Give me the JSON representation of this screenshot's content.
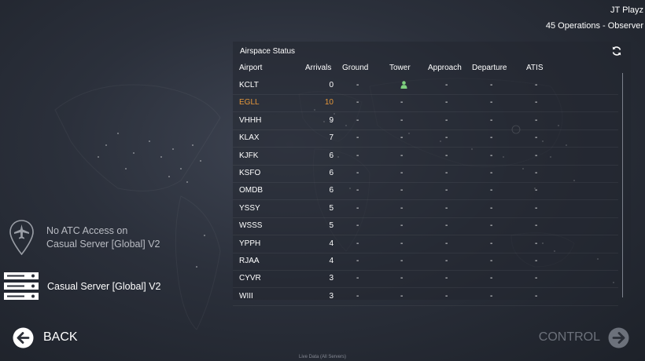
{
  "user": {
    "name": "JT Playz",
    "status": "45 Operations - Observer"
  },
  "panel": {
    "title": "Airspace Status",
    "columns": [
      "Airport",
      "Arrivals",
      "Ground",
      "Tower",
      "Approach",
      "Departure",
      "ATIS"
    ],
    "rows": [
      {
        "airport": "KCLT",
        "arrivals": "0",
        "ground": "-",
        "tower": "controller-icon",
        "approach": "-",
        "departure": "-",
        "atis": "-"
      },
      {
        "airport": "EGLL",
        "arrivals": "10",
        "ground": "-",
        "tower": "-",
        "approach": "-",
        "departure": "-",
        "atis": "-",
        "highlight": true
      },
      {
        "airport": "VHHH",
        "arrivals": "9",
        "ground": "-",
        "tower": "-",
        "approach": "-",
        "departure": "-",
        "atis": "-"
      },
      {
        "airport": "KLAX",
        "arrivals": "7",
        "ground": "-",
        "tower": "-",
        "approach": "-",
        "departure": "-",
        "atis": "-"
      },
      {
        "airport": "KJFK",
        "arrivals": "6",
        "ground": "-",
        "tower": "-",
        "approach": "-",
        "departure": "-",
        "atis": "-"
      },
      {
        "airport": "KSFO",
        "arrivals": "6",
        "ground": "-",
        "tower": "-",
        "approach": "-",
        "departure": "-",
        "atis": "-"
      },
      {
        "airport": "OMDB",
        "arrivals": "6",
        "ground": "-",
        "tower": "-",
        "approach": "-",
        "departure": "-",
        "atis": "-"
      },
      {
        "airport": "YSSY",
        "arrivals": "5",
        "ground": "-",
        "tower": "-",
        "approach": "-",
        "departure": "-",
        "atis": "-"
      },
      {
        "airport": "WSSS",
        "arrivals": "5",
        "ground": "-",
        "tower": "-",
        "approach": "-",
        "departure": "-",
        "atis": "-"
      },
      {
        "airport": "YPPH",
        "arrivals": "4",
        "ground": "-",
        "tower": "-",
        "approach": "-",
        "departure": "-",
        "atis": "-"
      },
      {
        "airport": "RJAA",
        "arrivals": "4",
        "ground": "-",
        "tower": "-",
        "approach": "-",
        "departure": "-",
        "atis": "-"
      },
      {
        "airport": "CYVR",
        "arrivals": "3",
        "ground": "-",
        "tower": "-",
        "approach": "-",
        "departure": "-",
        "atis": "-"
      },
      {
        "airport": "WIII",
        "arrivals": "3",
        "ground": "-",
        "tower": "-",
        "approach": "-",
        "departure": "-",
        "atis": "-"
      }
    ]
  },
  "sidebar": {
    "access_line1": "No ATC Access on",
    "access_line2": "Casual Server [Global] V2",
    "server_label": "Casual Server [Global] V2"
  },
  "nav": {
    "back_label": "BACK",
    "control_label": "CONTROL"
  },
  "footer": "Live Data (All Servers)",
  "colors": {
    "highlight": "#e4973a",
    "tower_active": "#7ed07e",
    "disabled": "#6c717b"
  }
}
